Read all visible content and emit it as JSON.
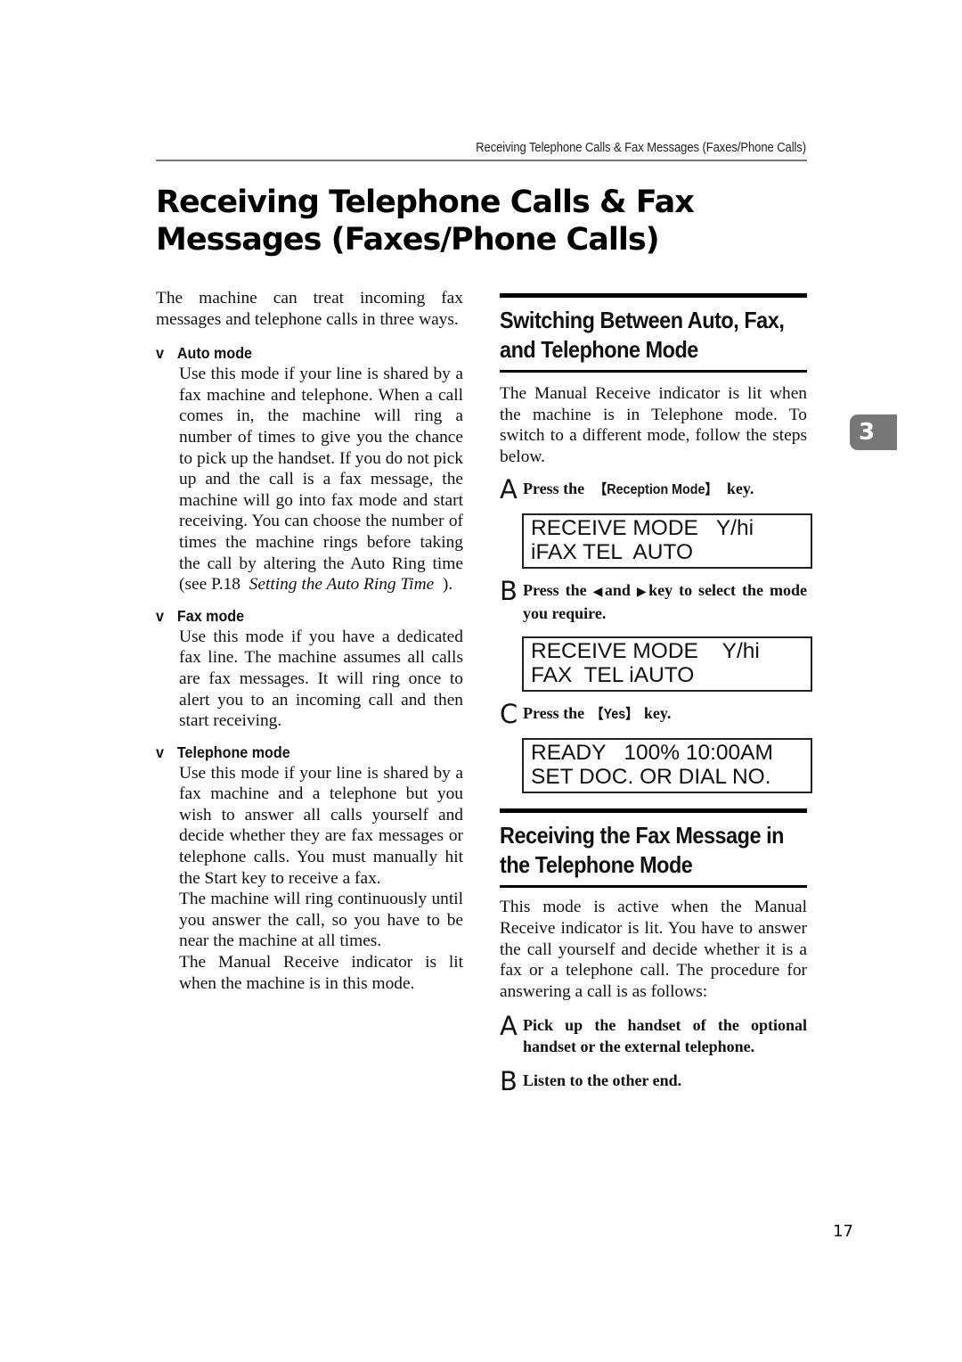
{
  "running_header": "Receiving Telephone Calls & Fax Messages (Faxes/Phone Calls)",
  "page_title": {
    "line1": "Receiving Telephone Calls & Fax",
    "line2": "Messages (Faxes/Phone Calls)"
  },
  "left_column": {
    "intro": "The machine can treat incoming fax messages and telephone calls in three ways.",
    "bullet_glyph": "v",
    "modes": [
      {
        "title": "Auto mode",
        "paragraphs": [
          "Use this mode if your line is shared by a fax machine and telephone. When a call comes in, the machine will ring a number of times to give you the chance to pick up the handset. If you do not pick up and the call is a fax message, the machine will go into fax mode and start receiving. You can choose the number of times the machine rings before taking the call by altering the Auto Ring time (see P.18"
        ],
        "xref_italic": "Setting the Auto Ring Time",
        "xref_close": ")."
      },
      {
        "title": "Fax mode",
        "paragraphs": [
          "Use this mode if you have a dedicated fax line. The machine assumes all calls are fax messages. It will ring once to alert you to an incoming call and then start receiving."
        ]
      },
      {
        "title": "Telephone mode",
        "paragraphs": [
          "Use this mode if your line is shared by a fax machine and a telephone but you wish to answer all calls yourself and decide whether they are fax messages or telephone calls. You must manually hit the Start key to receive a fax.",
          "The machine will ring continuously until you answer the call, so you have to be near the machine at all times.",
          "The Manual Receive indicator is lit when the machine is in this mode."
        ]
      }
    ]
  },
  "right_column": {
    "section1": {
      "title_line1": "Switching Between Auto, Fax,",
      "title_line2": "and Telephone Mode",
      "body": "The Manual Receive indicator is lit when the machine is in Telephone mode. To switch to a different mode, follow the steps below.",
      "steps": [
        {
          "letter": "A",
          "pre": "Press the ",
          "key": "【Reception Mode】",
          "post": " key."
        },
        {
          "letter": "B",
          "pre": "Press the ",
          "left_glyph": "◀",
          "mid": "and ",
          "right_glyph": "▶",
          "post": "key to select the mode you require."
        },
        {
          "letter": "C",
          "pre": "Press the ",
          "key": "【Yes】",
          "post": " key."
        }
      ],
      "lcd_displays": [
        {
          "line1": "RECEIVE MODE   Y/hi",
          "line2": "iFAX TEL  AUTO"
        },
        {
          "line1": "RECEIVE MODE    Y/hi",
          "line2": "FAX  TEL iAUTO"
        },
        {
          "line1": "READY   100% 10:00AM",
          "line2": "SET DOC. OR DIAL NO."
        }
      ]
    },
    "section2": {
      "title_line1": "Receiving the Fax Message in",
      "title_line2": "the Telephone Mode",
      "body": "This mode is active when the Manual Receive indicator is lit. You have to answer the call yourself and decide whether it is a fax or a telephone call. The procedure for answering a call is as follows:",
      "steps": [
        {
          "letter": "A",
          "text": "Pick up the handset of the optional handset or the external telephone."
        },
        {
          "letter": "B",
          "text": "Listen to the other end."
        }
      ]
    }
  },
  "chapter_tab": "3",
  "page_number": "17",
  "colors": {
    "text": "#111111",
    "rule_gray": "#777777",
    "tab_gray": "#777777"
  }
}
